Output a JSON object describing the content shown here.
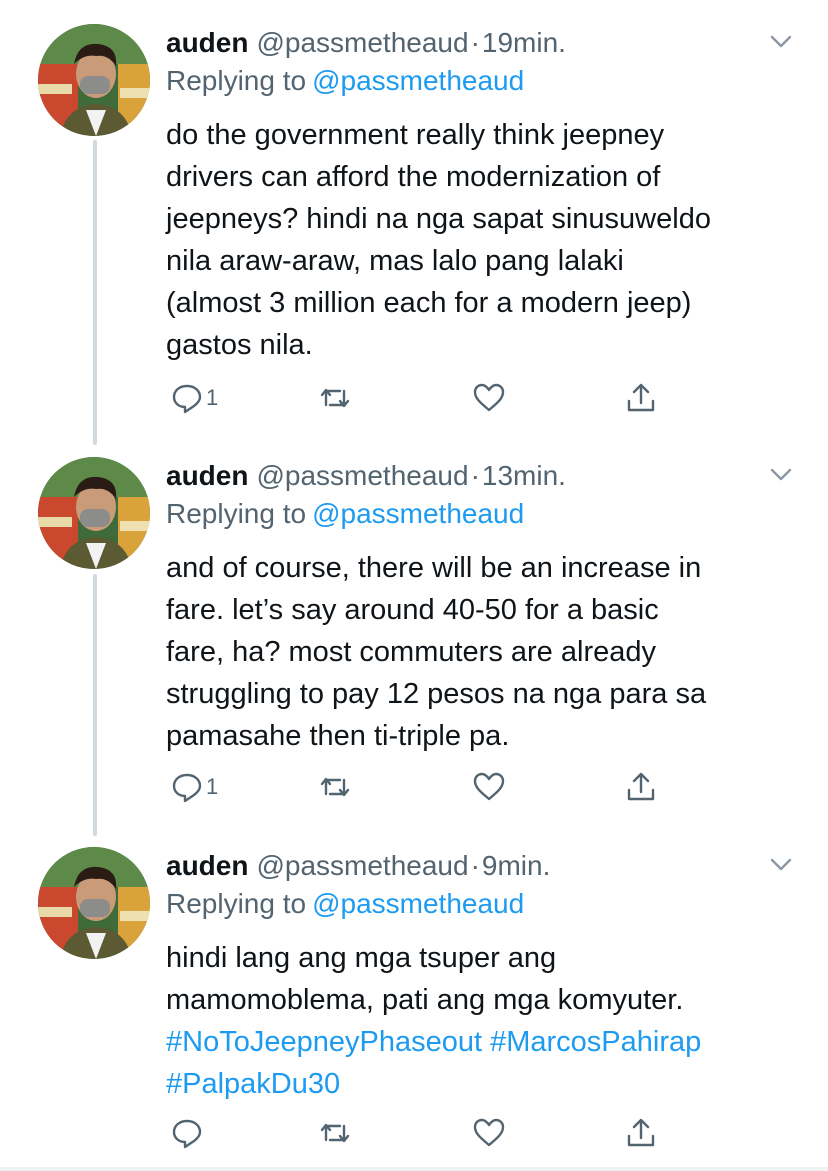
{
  "tweets": [
    {
      "name": "auden",
      "handle": "@passmetheaud",
      "dot": "·",
      "time": "19min.",
      "replying_prefix": "Replying to",
      "replying_to": "@passmetheaud",
      "text_lines": [
        "do the government really think jeepney",
        "drivers can afford the modernization of",
        "jeepneys? hindi na nga sapat sinusuweldo",
        "nila araw-araw, mas lalo pang lalaki",
        "(almost 3 million each for a modern jeep)",
        "gastos nila."
      ],
      "reply_count": "1",
      "icons": {
        "reply": "reply-icon",
        "retweet": "retweet-icon",
        "like": "heart-icon",
        "share": "share-icon",
        "menu": "chevron-down-icon"
      }
    },
    {
      "name": "auden",
      "handle": "@passmetheaud",
      "dot": "·",
      "time": "13min.",
      "replying_prefix": "Replying to",
      "replying_to": "@passmetheaud",
      "text_lines": [
        "and of course, there will be an increase in",
        "fare. let’s say around 40-50 for a basic",
        "fare, ha? most commuters are already",
        "struggling to pay 12 pesos na nga para sa",
        "pamasahe then ti-triple pa."
      ],
      "reply_count": "1",
      "icons": {
        "reply": "reply-icon",
        "retweet": "retweet-icon",
        "like": "heart-icon",
        "share": "share-icon",
        "menu": "chevron-down-icon"
      }
    },
    {
      "name": "auden",
      "handle": "@passmetheaud",
      "dot": "·",
      "time": "9min.",
      "replying_prefix": "Replying to",
      "replying_to": "@passmetheaud",
      "text_lines": [
        "hindi lang ang mga tsuper ang",
        "mamomoblema, pati ang mga komyuter."
      ],
      "hashtags": [
        "#NoToJeepneyPhaseout",
        "#MarcosPahirap",
        "#PalpakDu30"
      ],
      "reply_count": "",
      "icons": {
        "reply": "reply-icon",
        "retweet": "retweet-icon",
        "like": "heart-icon",
        "share": "share-icon",
        "menu": "chevron-down-icon"
      }
    }
  ],
  "colors": {
    "accent": "#1d9bf0",
    "text": "#0f1419",
    "muted": "#536471",
    "thread_line": "#cfd9de"
  }
}
